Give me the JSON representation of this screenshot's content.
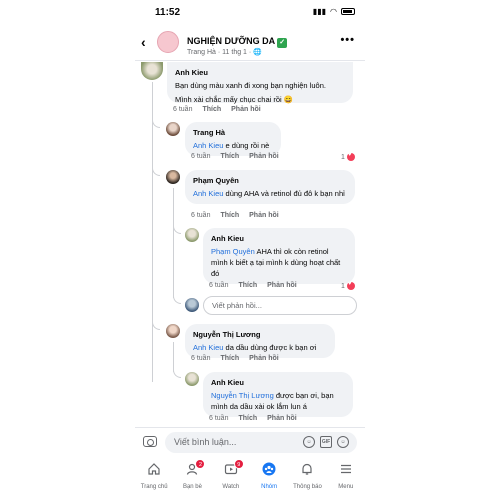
{
  "status": {
    "time": "11:52"
  },
  "header": {
    "group_name": "NGHIỆN DƯỠNG DA",
    "verified_mark": "✓",
    "author": "Trang Hà",
    "time": "11 thg 1",
    "privacy_icon": "globe-icon"
  },
  "comments": [
    {
      "author": "Anh Kieu",
      "lines": [
        "Bạn dùng màu xanh đi xong bạn nghiện luôn.",
        "Mình xài chắc mấy chục chai rồi 😄"
      ],
      "time": "6 tuần",
      "like": "Thích",
      "reply": "Phản hồi",
      "likes": null
    },
    {
      "author": "Trang Hà",
      "mention": "Anh Kieu",
      "text": " e dùng rồi nè",
      "time": "6 tuần",
      "like": "Thích",
      "reply": "Phản hồi",
      "likes": "1"
    },
    {
      "author": "Phạm Quyên",
      "mention": "Anh Kieu",
      "text": " dùng AHA và retinol đủ đô k bạn nhỉ",
      "time": "6 tuần",
      "like": "Thích",
      "reply": "Phản hồi",
      "likes": null
    },
    {
      "author": "Anh Kieu",
      "mention": "Phạm Quyên",
      "text": " AHA thì ok còn retinol mình k biết ạ tại mình k dùng hoạt chất đó",
      "time": "6 tuần",
      "like": "Thích",
      "reply": "Phản hồi",
      "likes": "1"
    },
    {
      "author": "Nguyễn Thị Lương",
      "mention": "Anh Kieu",
      "text": "  da dầu dùng được k bạn ơi",
      "time": "6 tuần",
      "like": "Thích",
      "reply": "Phản hồi",
      "likes": null
    },
    {
      "author": "Anh Kieu",
      "mention": "Nguyễn Thị Lương",
      "text": " được bạn ơi, bạn mình da dầu xài ok lắm lun á",
      "time": "6 tuần",
      "like": "Thích",
      "reply": "Phản hồi",
      "likes": null
    }
  ],
  "reply_placeholder": "Viết phản hồi...",
  "comment_placeholder": "Viết bình luận...",
  "comment_icons": [
    "emoji-face-icon",
    "gif-icon",
    "smiley-icon"
  ],
  "gif_label": "GIF",
  "tabs": [
    {
      "label": "Trang chủ",
      "icon": "home-icon",
      "badge": null,
      "active": false
    },
    {
      "label": "Bạn bè",
      "icon": "friends-icon",
      "badge": "2",
      "active": false
    },
    {
      "label": "Watch",
      "icon": "watch-icon",
      "badge": "9",
      "active": false
    },
    {
      "label": "Nhóm",
      "icon": "groups-icon",
      "badge": null,
      "active": true
    },
    {
      "label": "Thông báo",
      "icon": "bell-icon",
      "badge": null,
      "active": false
    },
    {
      "label": "Menu",
      "icon": "menu-icon",
      "badge": null,
      "active": false
    }
  ],
  "colors": {
    "accent": "#1877f2",
    "mention": "#216fdb",
    "badge": "#e41e3f",
    "like": "#f33e58"
  }
}
